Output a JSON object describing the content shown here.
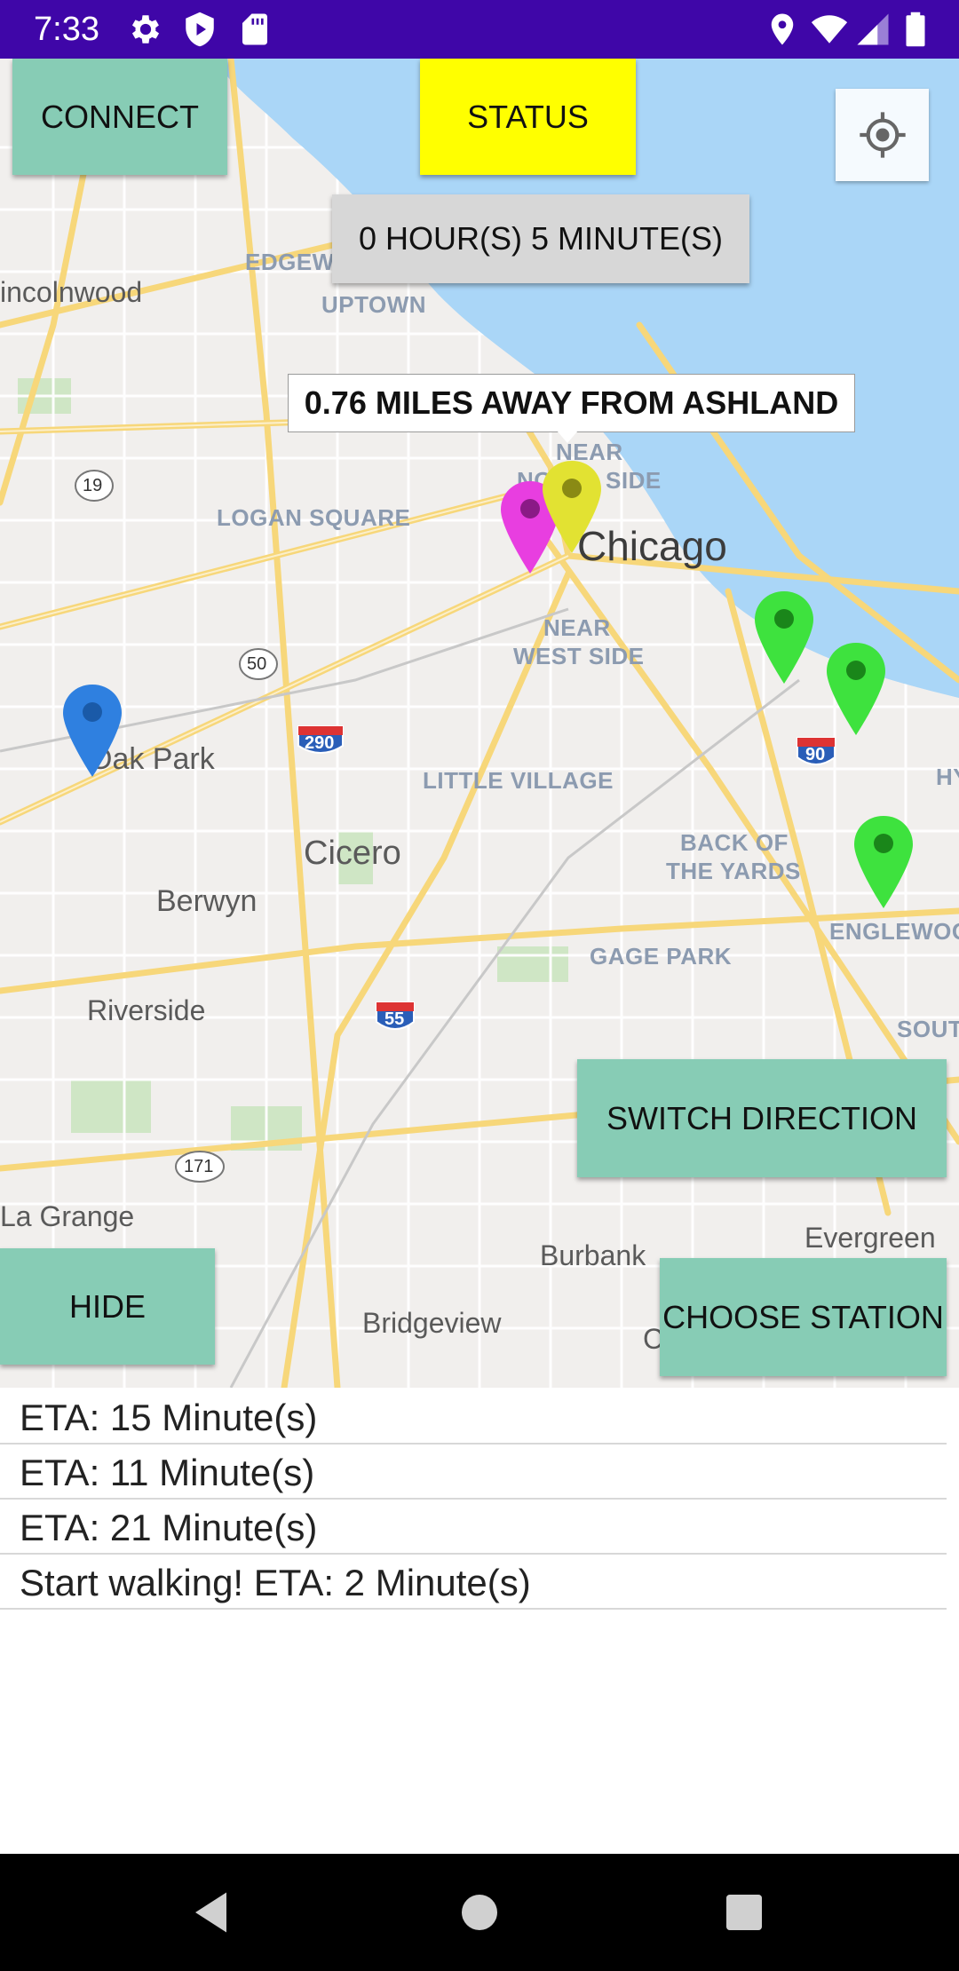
{
  "status_bar": {
    "time": "7:33",
    "background_color": "#3f06a8",
    "left_icons": [
      "gear-icon",
      "shield-play-icon",
      "sd-card-icon"
    ],
    "right_icons": [
      "location-icon",
      "wifi-icon",
      "cellular-icon",
      "battery-icon"
    ]
  },
  "toolbar": {
    "connect_label": "CONNECT",
    "status_label": "STATUS",
    "timer_label": "0 HOUR(S) 5 MINUTE(S)",
    "location_icon": "my-location-icon"
  },
  "map": {
    "info_window": "0.76 MILES AWAY FROM ASHLAND",
    "labels": {
      "edgewater": "EDGEWA",
      "uptown": "UPTOWN",
      "lincolnwood": "incolnwood",
      "near_north_1": "NEAR",
      "near_north_2": "NO",
      "near_north_3": "SIDE",
      "logan_square": "LOGAN SQUARE",
      "chicago": "Chicago",
      "near_west_1": "NEAR",
      "near_west_2": "WEST SIDE",
      "oak_park": "Oak Park",
      "little_village": "LITTLE VILLAGE",
      "cicero": "Cicero",
      "berwyn": "Berwyn",
      "back_of_yards_1": "BACK OF",
      "back_of_yards_2": "THE YARDS",
      "englewood": "ENGLEWOO",
      "gage_park": "GAGE PARK",
      "riverside": "Riverside",
      "south": "SOUT",
      "hy": "HY",
      "la_grange": "La Grange",
      "evergreen": "Evergreen",
      "burbank": "Burbank",
      "bridgeview": "Bridgeview",
      "c_partial": "C"
    },
    "shields": {
      "r19": "19",
      "r50": "50",
      "i290": "290",
      "i90": "90",
      "i55": "55",
      "r171": "171"
    },
    "marker_colors": {
      "user": "#2f80e0",
      "yellow": "#e2e232",
      "magenta": "#e83ee0",
      "green": "#3ee23e"
    }
  },
  "buttons": {
    "switch_direction": "SWITCH DIRECTION",
    "hide": "HIDE",
    "choose_station": "CHOOSE STATION"
  },
  "eta_list": [
    "ETA: 15 Minute(s)",
    "ETA: 11 Minute(s)",
    "ETA: 21 Minute(s)",
    "Start walking! ETA: 2 Minute(s)"
  ],
  "nav_bar": {
    "icons": [
      "back-icon",
      "home-icon",
      "recents-icon"
    ]
  }
}
